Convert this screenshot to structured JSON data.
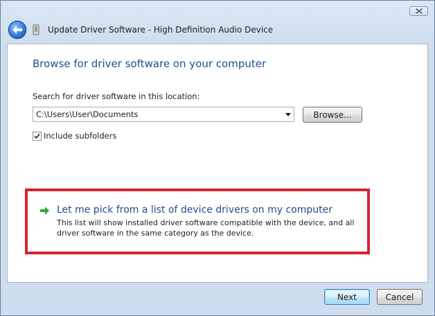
{
  "window": {
    "title": "Update Driver Software - High Definition Audio Device"
  },
  "icons": {
    "close": "close-icon",
    "back": "back-arrow-icon",
    "device": "audio-device-icon",
    "link_arrow": "green-arrow-icon",
    "checkmark": "checkmark-icon"
  },
  "content": {
    "title": "Browse for driver software on your computer",
    "search_label": "Search for driver software in this location:",
    "path_value": "C:\\Users\\User\\Documents",
    "browse_label": "Browse...",
    "include_subfolders_label": "Include subfolders",
    "include_subfolders_checked": true,
    "pick_title": "Let me pick from a list of device drivers on my computer",
    "pick_description": "This list will show installed driver software compatible with the device, and all driver software in the same category as the device."
  },
  "footer": {
    "next_label": "Next",
    "cancel_label": "Cancel"
  },
  "colors": {
    "link_blue": "#1f4e8c",
    "highlight_red": "#d42431",
    "arrow_green": "#2fa63a"
  }
}
